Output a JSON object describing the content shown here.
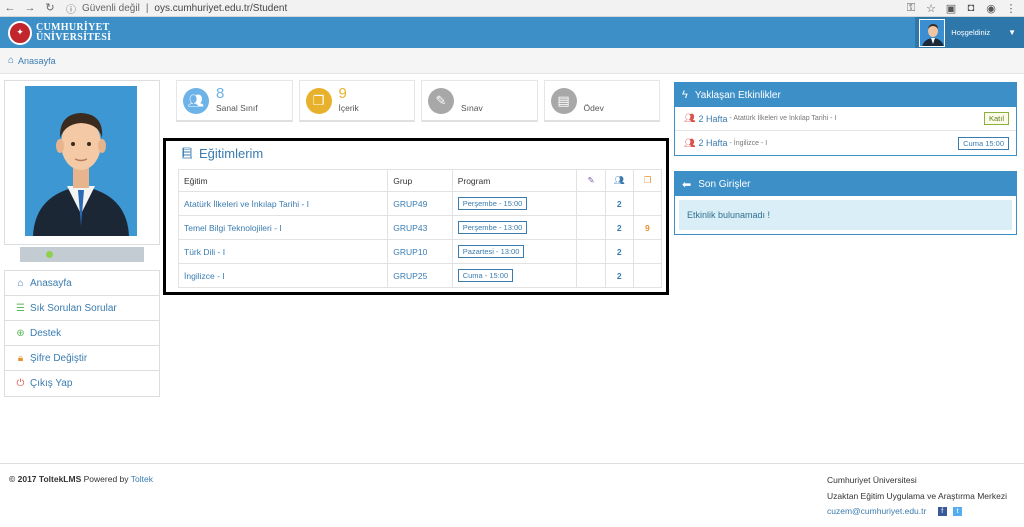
{
  "browser": {
    "security": "Güvenli değil",
    "url": "oys.cumhuriyet.edu.tr/Student"
  },
  "header": {
    "brand_line1": "CUMHURİYET",
    "brand_line2": "ÜNİVERSİTESİ",
    "welcome": "Hoşgeldiniz"
  },
  "breadcrumb": {
    "home": "Anasayfa"
  },
  "sidebar": {
    "items": [
      {
        "label": "Anasayfa",
        "icon": "home-icon"
      },
      {
        "label": "Sık Sorulan Sorular",
        "icon": "list-icon"
      },
      {
        "label": "Destek",
        "icon": "lifebuoy-icon"
      },
      {
        "label": "Şifre Değiştir",
        "icon": "lock-icon"
      },
      {
        "label": "Çıkış Yap",
        "icon": "power-icon"
      }
    ]
  },
  "stats": [
    {
      "value": "8",
      "label": "Sanal Sınıf",
      "color": "#6eb3e8",
      "icon": "users-icon"
    },
    {
      "value": "9",
      "label": "İçerik",
      "color": "#e8b12c",
      "icon": "files-icon"
    },
    {
      "value": "",
      "label": "Sınav",
      "color": "#a8a8a8",
      "icon": "pencil-icon"
    },
    {
      "value": "",
      "label": "Ödev",
      "color": "#a8a8a8",
      "icon": "briefcase-icon"
    }
  ],
  "trainings": {
    "title": "Eğitimlerim",
    "columns": [
      "Eğitim",
      "Grup",
      "Program"
    ],
    "rows": [
      {
        "course": "Atatürk İlkeleri ve İnkılap Tarihi - I",
        "group": "GRUP49",
        "schedule": "Perşembe - 15:00",
        "users": "2",
        "files": ""
      },
      {
        "course": "Temel Bilgi Teknolojileri - I",
        "group": "GRUP43",
        "schedule": "Perşembe - 13:00",
        "users": "2",
        "files": "9"
      },
      {
        "course": "Türk Dili - I",
        "group": "GRUP10",
        "schedule": "Pazartesi - 13:00",
        "users": "2",
        "files": ""
      },
      {
        "course": "İngilizce - I",
        "group": "GRUP25",
        "schedule": "Cuma - 15:00",
        "users": "2",
        "files": ""
      }
    ]
  },
  "upcoming": {
    "title": "Yaklaşan Etkinlikler",
    "items": [
      {
        "week": "2 Hafta",
        "name": "- Atatürk İlkeleri ve İnkılap Tarihi - I",
        "badge": "Katıl"
      },
      {
        "week": "2 Hafta",
        "name": "- İngilizce - I",
        "badge": "Cuma 15:00"
      }
    ]
  },
  "recent": {
    "title": "Son Girişler",
    "empty": "Etkinlik bulunamadı !"
  },
  "footer": {
    "copyright_year": "© 2017 ToltekLMS",
    "powered": "Powered by",
    "company": "Toltek",
    "org1": "Cumhuriyet Üniversitesi",
    "org2": "Uzaktan Eğitim Uygulama ve Araştırma Merkezi",
    "email": "cuzem@cumhuriyet.edu.tr"
  }
}
